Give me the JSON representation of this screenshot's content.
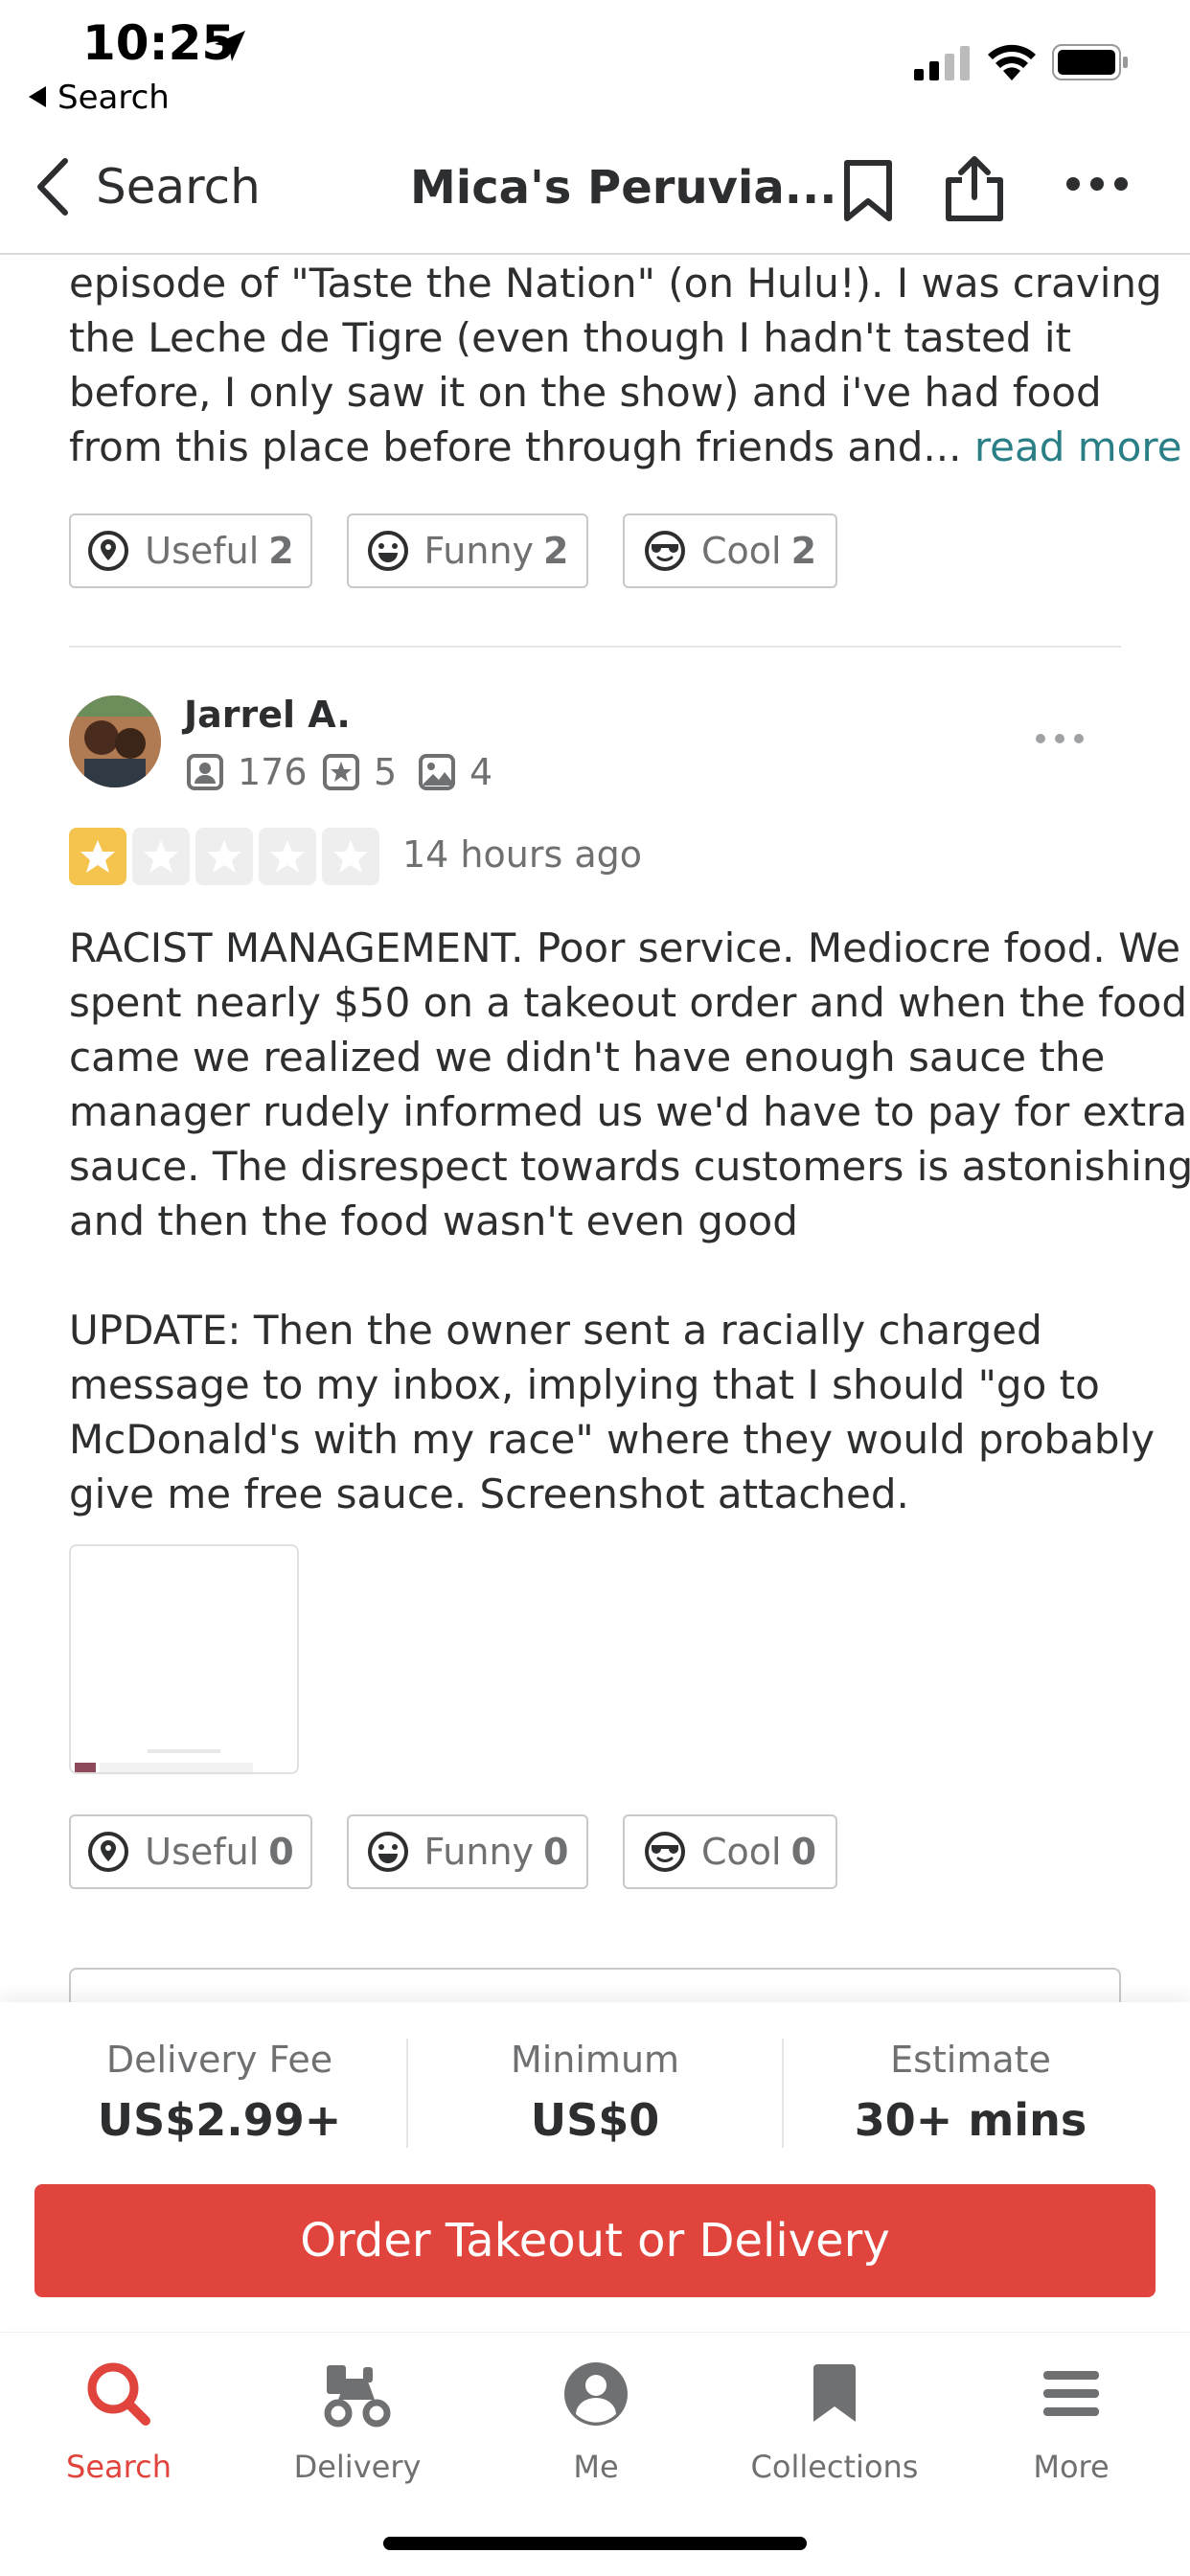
{
  "status_bar": {
    "time": "10:25",
    "back_app": "Search"
  },
  "nav": {
    "back_label": "Search",
    "title": "Mica's Peruvia..."
  },
  "prev_review": {
    "lines": [
      "episode of \"Taste the Nation\" (on Hulu!). I was craving",
      "the Leche de Tigre (even though I hadn't tasted it",
      "before, I only saw it on the show) and i've had food",
      "from this place before through friends and..."
    ],
    "read_more": "read more",
    "votes": {
      "useful_label": "Useful",
      "useful_count": "2",
      "funny_label": "Funny",
      "funny_count": "2",
      "cool_label": "Cool",
      "cool_count": "2"
    }
  },
  "review": {
    "name": "Jarrel A.",
    "friends": "176",
    "reviews": "5",
    "photos": "4",
    "rating": 1,
    "date": "14 hours ago",
    "lines": [
      "RACIST MANAGEMENT. Poor service. Mediocre food. We",
      "spent nearly $50 on a takeout order and when the food",
      "came we realized we didn't have enough sauce the",
      "manager rudely informed us we'd have to pay for extra",
      "sauce. The disrespect towards customers is astonishing",
      "and then the food wasn't even good",
      "",
      "UPDATE: Then the owner sent a racially charged",
      "message to my inbox, implying that I should \"go to",
      "McDonald's with my race\" where they would probably",
      "give me free sauce. Screenshot attached."
    ],
    "votes": {
      "useful_label": "Useful",
      "useful_count": "0",
      "funny_label": "Funny",
      "funny_count": "0",
      "cool_label": "Cool",
      "cool_count": "0"
    }
  },
  "delivery": {
    "fee_label": "Delivery Fee",
    "fee_value": "US$2.99+",
    "min_label": "Minimum",
    "min_value": "US$0",
    "est_label": "Estimate",
    "est_value": "30+ mins",
    "order_button": "Order Takeout or Delivery"
  },
  "tabs": [
    {
      "label": "Search"
    },
    {
      "label": "Delivery"
    },
    {
      "label": "Me"
    },
    {
      "label": "Collections"
    },
    {
      "label": "More"
    }
  ],
  "colors": {
    "accent": "#e0443c",
    "link": "#2a7f86",
    "star": "#f4c44e"
  }
}
